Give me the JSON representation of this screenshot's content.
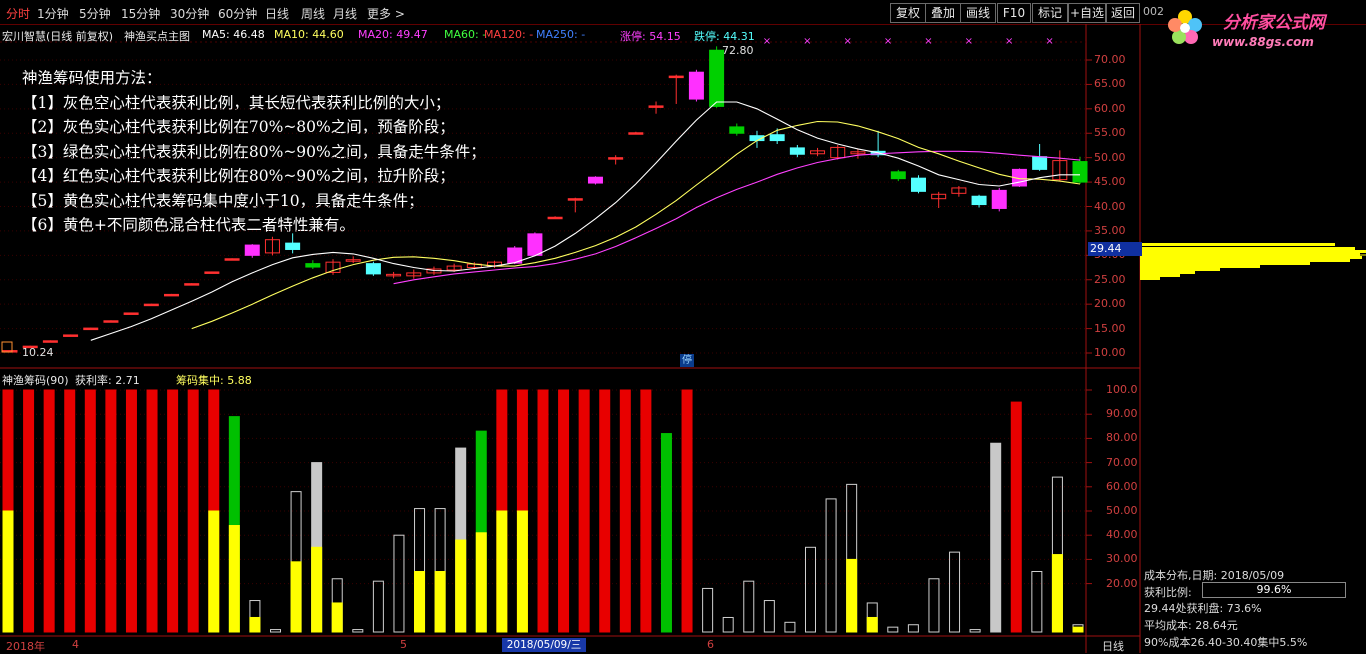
{
  "toolbar": {
    "periods": [
      "分时",
      "1分钟",
      "5分钟",
      "15分钟",
      "30分钟",
      "60分钟",
      "日线",
      "周线",
      "月线",
      "更多 >"
    ],
    "buttons": [
      "复权",
      "叠加",
      "画线",
      "F10",
      "标记",
      "+自选",
      "返回"
    ],
    "code_fragment": "002"
  },
  "logo": {
    "title": "分析家公式网",
    "url": "www.88gs.com"
  },
  "main_info": {
    "stock": "宏川智慧(日线 前复权)",
    "formula": "神渔买点主图",
    "ma5": "MA5: 46.48",
    "ma10": "MA10: 44.60",
    "ma20": "MA20: 49.47",
    "ma60": "MA60: -",
    "ma120": "MA120: -",
    "ma250": "MA250: -",
    "limit_up": "涨停: 54.15",
    "limit_down": "跌停: 44.31",
    "high_label": "72.80",
    "low_label": "10.24",
    "stop_tag": "停",
    "current_price": "29.44"
  },
  "method": {
    "title": "神渔筹码使用方法：",
    "lines": [
      "【1】灰色空心柱代表获利比例，其长短代表获利比例的大小；",
      "【2】灰色实心柱代表获利比例在70%~80%之间，预备阶段；",
      "【3】绿色实心柱代表获利比例在80%~90%之间，具备走牛条件；",
      "【4】红色实心柱代表获利比例在80%~90%之间，拉升阶段；",
      "【5】黄色实心柱代表筹码集中度小于10，具备走牛条件；",
      "【6】黄色+不同颜色混合柱代表二者特性兼有。"
    ]
  },
  "sub_info": {
    "name": "神渔筹码(90)",
    "profit_rate": "获利率: 2.71",
    "concentration": "筹码集中: 5.88"
  },
  "price_axis": [
    "70.00",
    "65.00",
    "60.00",
    "55.00",
    "50.00",
    "45.00",
    "40.00",
    "35.00",
    "30.00",
    "25.00",
    "20.00",
    "15.00",
    "10.00"
  ],
  "sub_axis": [
    "100.0",
    "90.00",
    "80.00",
    "70.00",
    "60.00",
    "50.00",
    "40.00",
    "30.00",
    "20.00"
  ],
  "date_axis": {
    "year": "2018年",
    "m4": "4",
    "m5": "5",
    "m6": "6",
    "cursor_date": "2018/05/09/三",
    "period": "日线"
  },
  "dist_panel": {
    "title": "成本分布,日期: 2018/05/09",
    "profit_label": "获利比例:",
    "profit_value": "99.6%",
    "line1": "29.44处获利盘: 73.6%",
    "line2": "平均成本: 28.64元",
    "line3": "90%成本26.40-30.40集中5.5%"
  },
  "colors": {
    "up": "#ff3030",
    "down": "#54ffff",
    "ma5": "#ffffff",
    "ma10": "#ffff60",
    "ma20": "#ff40ff",
    "green": "#00d000",
    "yellow": "#ffff00",
    "gray": "#c0c0c0",
    "bg": "#000000"
  },
  "chart_data": {
    "type": "candlestick",
    "candles": [
      {
        "o": 10.3,
        "c": 10.5,
        "h": 10.6,
        "l": 10.2,
        "k": "line"
      },
      {
        "o": 11.3,
        "c": 11.4,
        "h": 11.5,
        "l": 11.2,
        "k": "line"
      },
      {
        "o": 12.4,
        "c": 12.5,
        "h": 12.6,
        "l": 12.3,
        "k": "line"
      },
      {
        "o": 13.6,
        "c": 13.7,
        "h": 13.8,
        "l": 13.5,
        "k": "line"
      },
      {
        "o": 15.0,
        "c": 15.1,
        "h": 15.2,
        "l": 14.9,
        "k": "line"
      },
      {
        "o": 16.5,
        "c": 16.6,
        "h": 16.7,
        "l": 16.4,
        "k": "line"
      },
      {
        "o": 18.1,
        "c": 18.2,
        "h": 18.3,
        "l": 18.0,
        "k": "line"
      },
      {
        "o": 19.9,
        "c": 20.0,
        "h": 20.1,
        "l": 19.8,
        "k": "line"
      },
      {
        "o": 21.9,
        "c": 22.0,
        "h": 22.1,
        "l": 21.8,
        "k": "line"
      },
      {
        "o": 24.1,
        "c": 24.2,
        "h": 24.3,
        "l": 24.0,
        "k": "line"
      },
      {
        "o": 26.5,
        "c": 26.6,
        "h": 26.7,
        "l": 26.4,
        "k": "line"
      },
      {
        "o": 29.2,
        "c": 29.3,
        "h": 29.4,
        "l": 29.1,
        "k": "line"
      },
      {
        "o": 30.0,
        "c": 32.1,
        "h": 32.3,
        "l": 29.5,
        "k": "magenta"
      },
      {
        "o": 30.5,
        "c": 33.2,
        "h": 33.8,
        "l": 30.0,
        "k": "upHollow"
      },
      {
        "o": 32.5,
        "c": 31.2,
        "h": 34.5,
        "l": 30.4,
        "k": "cyan"
      },
      {
        "o": 28.3,
        "c": 27.6,
        "h": 29.0,
        "l": 27.2,
        "k": "green"
      },
      {
        "o": 26.5,
        "c": 28.6,
        "h": 29.2,
        "l": 26.0,
        "k": "upHollow"
      },
      {
        "o": 28.9,
        "c": 29.1,
        "h": 29.8,
        "l": 28.4,
        "k": "upHollow"
      },
      {
        "o": 28.3,
        "c": 26.2,
        "h": 28.7,
        "l": 25.8,
        "k": "cyan"
      },
      {
        "o": 26.1,
        "c": 25.8,
        "h": 26.6,
        "l": 25.3,
        "k": "upHollow"
      },
      {
        "o": 25.8,
        "c": 26.4,
        "h": 27.1,
        "l": 25.2,
        "k": "upHollow"
      },
      {
        "o": 26.4,
        "c": 27.2,
        "h": 27.7,
        "l": 26.0,
        "k": "upHollow"
      },
      {
        "o": 27.0,
        "c": 27.8,
        "h": 28.3,
        "l": 26.6,
        "k": "upHollow"
      },
      {
        "o": 27.5,
        "c": 28.2,
        "h": 28.6,
        "l": 27.1,
        "k": "upHollow"
      },
      {
        "o": 27.8,
        "c": 28.6,
        "h": 28.9,
        "l": 27.4,
        "k": "upHollow"
      },
      {
        "o": 28.4,
        "c": 31.5,
        "h": 31.9,
        "l": 28.2,
        "k": "magenta"
      },
      {
        "o": 30.0,
        "c": 34.4,
        "h": 34.7,
        "l": 29.8,
        "k": "magenta"
      },
      {
        "o": 37.7,
        "c": 37.8,
        "h": 38.0,
        "l": 37.6,
        "k": "line"
      },
      {
        "o": 41.5,
        "c": 41.6,
        "h": 41.8,
        "l": 38.8,
        "k": "line"
      },
      {
        "o": 44.8,
        "c": 46.0,
        "h": 46.2,
        "l": 44.5,
        "k": "magenta"
      },
      {
        "o": 49.9,
        "c": 50.0,
        "h": 50.5,
        "l": 48.6,
        "k": "line"
      },
      {
        "o": 55.0,
        "c": 55.1,
        "h": 55.3,
        "l": 54.8,
        "k": "line"
      },
      {
        "o": 60.5,
        "c": 60.6,
        "h": 61.5,
        "l": 59.0,
        "k": "line"
      },
      {
        "o": 66.6,
        "c": 66.7,
        "h": 67.0,
        "l": 61.0,
        "k": "line"
      },
      {
        "o": 62.0,
        "c": 67.5,
        "h": 68.0,
        "l": 61.5,
        "k": "magenta"
      },
      {
        "o": 72.0,
        "c": 60.5,
        "h": 72.8,
        "l": 60.2,
        "k": "green"
      },
      {
        "o": 56.3,
        "c": 55.0,
        "h": 57.0,
        "l": 54.5,
        "k": "green"
      },
      {
        "o": 54.5,
        "c": 53.5,
        "h": 55.5,
        "l": 52.0,
        "k": "cyan"
      },
      {
        "o": 54.7,
        "c": 53.5,
        "h": 56.0,
        "l": 52.8,
        "k": "cyan"
      },
      {
        "o": 52.0,
        "c": 50.7,
        "h": 52.6,
        "l": 50.1,
        "k": "cyan"
      },
      {
        "o": 50.8,
        "c": 51.4,
        "h": 52.0,
        "l": 50.3,
        "k": "upHollow"
      },
      {
        "o": 50.0,
        "c": 52.1,
        "h": 52.6,
        "l": 49.6,
        "k": "upHollow"
      },
      {
        "o": 51.2,
        "c": 50.8,
        "h": 51.8,
        "l": 49.8,
        "k": "upHollow"
      },
      {
        "o": 51.3,
        "c": 50.6,
        "h": 55.5,
        "l": 50.1,
        "k": "cyan"
      },
      {
        "o": 47.1,
        "c": 45.7,
        "h": 47.5,
        "l": 45.2,
        "k": "green"
      },
      {
        "o": 45.8,
        "c": 43.1,
        "h": 46.4,
        "l": 42.7,
        "k": "cyan"
      },
      {
        "o": 41.6,
        "c": 42.5,
        "h": 43.0,
        "l": 39.7,
        "k": "upHollow"
      },
      {
        "o": 42.7,
        "c": 43.8,
        "h": 44.2,
        "l": 42.0,
        "k": "upHollow"
      },
      {
        "o": 42.1,
        "c": 40.4,
        "h": 42.4,
        "l": 39.8,
        "k": "cyan"
      },
      {
        "o": 39.6,
        "c": 43.3,
        "h": 43.8,
        "l": 39.0,
        "k": "magenta"
      },
      {
        "o": 44.2,
        "c": 47.6,
        "h": 47.8,
        "l": 44.0,
        "k": "magenta"
      },
      {
        "o": 47.6,
        "c": 50.2,
        "h": 52.8,
        "l": 47.3,
        "k": "cyan"
      },
      {
        "o": 45.5,
        "c": 49.4,
        "h": 51.5,
        "l": 45.1,
        "k": "upHollow"
      },
      {
        "o": 49.2,
        "c": 45.0,
        "h": 50.2,
        "l": 44.6,
        "k": "green"
      }
    ],
    "ma5": [
      null,
      null,
      null,
      null,
      12.6,
      14.0,
      15.4,
      17.0,
      18.8,
      20.6,
      22.5,
      24.6,
      26.4,
      28.1,
      29.5,
      30.2,
      30.6,
      30.3,
      29.4,
      28.3,
      27.5,
      26.9,
      26.8,
      27.3,
      27.8,
      28.5,
      29.9,
      31.9,
      34.5,
      37.5,
      40.8,
      44.6,
      48.9,
      53.4,
      57.7,
      61.4,
      61.4,
      60.0,
      57.9,
      55.7,
      54.0,
      52.8,
      51.8,
      51.0,
      49.9,
      48.3,
      46.5,
      45.5,
      44.5,
      44.2,
      45.0,
      45.9,
      46.5,
      46.5
    ],
    "ma10": [
      null,
      null,
      null,
      null,
      null,
      null,
      null,
      null,
      null,
      15.0,
      16.5,
      18.2,
      20.0,
      21.9,
      23.7,
      25.4,
      26.9,
      28.1,
      29.0,
      29.6,
      29.7,
      29.4,
      28.9,
      28.2,
      27.8,
      27.8,
      28.5,
      29.4,
      30.6,
      32.0,
      33.7,
      35.8,
      38.4,
      41.2,
      44.4,
      47.5,
      50.7,
      53.5,
      55.6,
      56.6,
      57.4,
      57.3,
      56.5,
      55.3,
      53.9,
      52.1,
      50.8,
      49.3,
      47.9,
      46.6,
      45.7,
      45.6,
      45.2,
      44.6
    ],
    "ma20": [
      null,
      null,
      null,
      null,
      null,
      null,
      null,
      null,
      null,
      null,
      null,
      null,
      null,
      null,
      null,
      null,
      null,
      null,
      null,
      24.2,
      25.0,
      25.6,
      26.2,
      26.6,
      27.0,
      27.4,
      27.7,
      28.3,
      29.2,
      30.3,
      31.8,
      33.6,
      35.5,
      37.5,
      39.8,
      41.8,
      43.5,
      45.0,
      46.6,
      47.9,
      49.0,
      49.8,
      50.5,
      50.8,
      51.0,
      51.2,
      51.3,
      51.3,
      51.2,
      50.9,
      50.5,
      50.2,
      49.9,
      49.5
    ],
    "profit_bars": [
      {
        "v": 100,
        "c": "red",
        "y": 50
      },
      {
        "v": 100,
        "c": "red",
        "y": 0
      },
      {
        "v": 100,
        "c": "red",
        "y": 0
      },
      {
        "v": 100,
        "c": "red",
        "y": 0
      },
      {
        "v": 100,
        "c": "red",
        "y": 0
      },
      {
        "v": 100,
        "c": "red",
        "y": 0
      },
      {
        "v": 100,
        "c": "red",
        "y": 0
      },
      {
        "v": 100,
        "c": "red",
        "y": 0
      },
      {
        "v": 100,
        "c": "red",
        "y": 0
      },
      {
        "v": 100,
        "c": "red",
        "y": 0
      },
      {
        "v": 100,
        "c": "red",
        "y": 50
      },
      {
        "v": 89,
        "c": "green",
        "y": 44
      },
      {
        "v": 13,
        "c": "hollow",
        "y": 6
      },
      {
        "v": 1,
        "c": "hollow",
        "y": 0
      },
      {
        "v": 58,
        "c": "hollow",
        "y": 29
      },
      {
        "v": 70,
        "c": "gray",
        "y": 35
      },
      {
        "v": 22,
        "c": "hollow",
        "y": 12
      },
      {
        "v": 1,
        "c": "hollow",
        "y": 0
      },
      {
        "v": 21,
        "c": "hollow",
        "y": 0
      },
      {
        "v": 40,
        "c": "hollow",
        "y": 0
      },
      {
        "v": 51,
        "c": "hollow",
        "y": 25
      },
      {
        "v": 51,
        "c": "hollow",
        "y": 25
      },
      {
        "v": 76,
        "c": "gray",
        "y": 38
      },
      {
        "v": 83,
        "c": "green",
        "y": 41
      },
      {
        "v": 100,
        "c": "red",
        "y": 50
      },
      {
        "v": 100,
        "c": "red",
        "y": 50
      },
      {
        "v": 100,
        "c": "red",
        "y": 0
      },
      {
        "v": 100,
        "c": "red",
        "y": 0
      },
      {
        "v": 100,
        "c": "red",
        "y": 0
      },
      {
        "v": 100,
        "c": "red",
        "y": 0
      },
      {
        "v": 100,
        "c": "red",
        "y": 0
      },
      {
        "v": 100,
        "c": "red",
        "y": 0
      },
      {
        "v": 82,
        "c": "green",
        "y": 0
      },
      {
        "v": 100,
        "c": "red",
        "y": 0
      },
      {
        "v": 18,
        "c": "hollow",
        "y": 0
      },
      {
        "v": 6,
        "c": "hollow",
        "y": 0
      },
      {
        "v": 21,
        "c": "hollow",
        "y": 0
      },
      {
        "v": 13,
        "c": "hollow",
        "y": 0
      },
      {
        "v": 4,
        "c": "hollow",
        "y": 0
      },
      {
        "v": 35,
        "c": "hollow",
        "y": 0
      },
      {
        "v": 55,
        "c": "hollow",
        "y": 0
      },
      {
        "v": 61,
        "c": "hollow",
        "y": 30
      },
      {
        "v": 12,
        "c": "hollow",
        "y": 6
      },
      {
        "v": 2,
        "c": "hollow",
        "y": 0
      },
      {
        "v": 3,
        "c": "hollow",
        "y": 0
      },
      {
        "v": 22,
        "c": "hollow",
        "y": 0
      },
      {
        "v": 33,
        "c": "hollow",
        "y": 0
      },
      {
        "v": 1,
        "c": "hollow",
        "y": 0
      },
      {
        "v": 78,
        "c": "gray",
        "y": 0
      },
      {
        "v": 95,
        "c": "red",
        "y": 0
      },
      {
        "v": 25,
        "c": "hollow",
        "y": 0
      },
      {
        "v": 64,
        "c": "hollow",
        "y": 32
      },
      {
        "v": 3,
        "c": "hollow",
        "y": 2
      }
    ],
    "ylim_price": [
      10,
      72.8
    ],
    "ylim_sub": [
      0,
      100
    ]
  }
}
